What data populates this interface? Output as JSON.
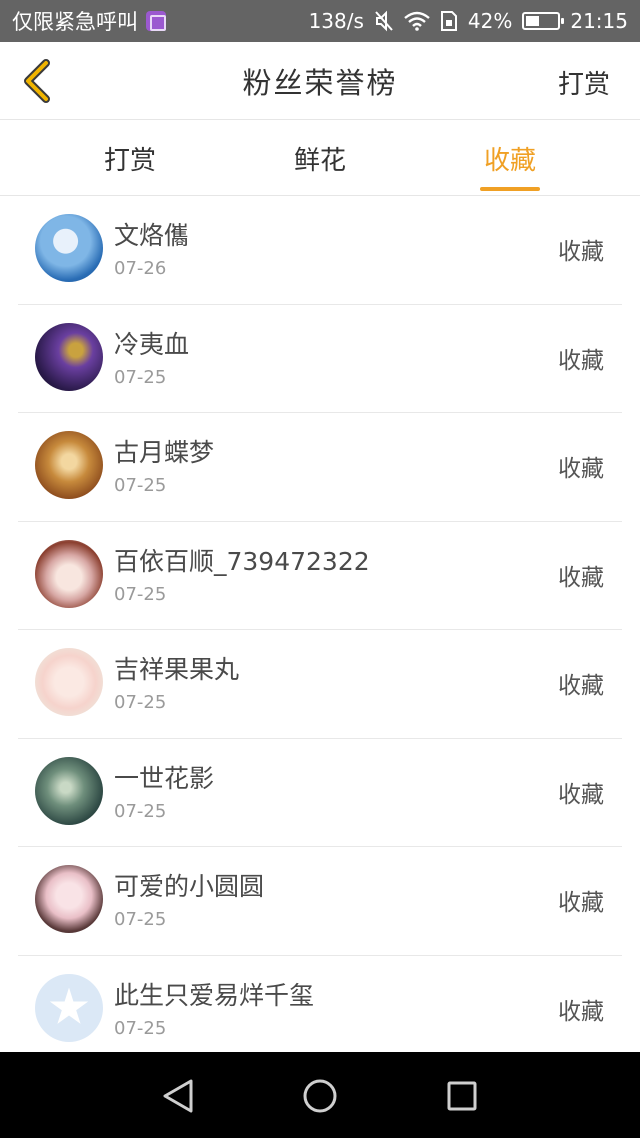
{
  "status_bar": {
    "carrier": "仅限紧急呼叫",
    "speed": "138/s",
    "battery": "42%",
    "battery_level": 0.42,
    "time": "21:15"
  },
  "header": {
    "title": "粉丝荣誉榜",
    "action_label": "打赏"
  },
  "tabs": [
    {
      "label": "打赏",
      "active": false
    },
    {
      "label": "鲜花",
      "active": false
    },
    {
      "label": "收藏",
      "active": true
    }
  ],
  "accent_color": "#f0a024",
  "rows": [
    {
      "name": "文烙儶",
      "date": "07-26",
      "action": "收藏"
    },
    {
      "name": "冷夷血",
      "date": "07-25",
      "action": "收藏"
    },
    {
      "name": "古月蝶梦",
      "date": "07-25",
      "action": "收藏"
    },
    {
      "name": "百依百顺_739472322",
      "date": "07-25",
      "action": "收藏"
    },
    {
      "name": "吉祥果果丸",
      "date": "07-25",
      "action": "收藏"
    },
    {
      "name": "一世花影",
      "date": "07-25",
      "action": "收藏"
    },
    {
      "name": "可爱的小圆圆",
      "date": "07-25",
      "action": "收藏"
    },
    {
      "name": "此生只爱易烊千玺",
      "date": "07-25",
      "action": "收藏"
    }
  ]
}
